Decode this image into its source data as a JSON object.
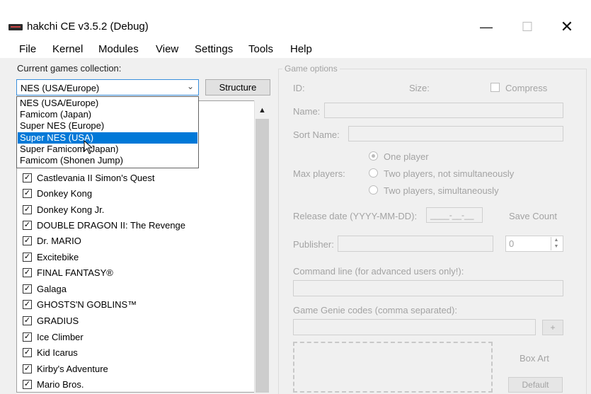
{
  "window": {
    "title": "hakchi CE v3.5.2 (Debug)",
    "minimize": "—",
    "maximize": "☐",
    "close": "✕"
  },
  "menu": [
    "File",
    "Kernel",
    "Modules",
    "View",
    "Settings",
    "Tools",
    "Help"
  ],
  "collection": {
    "label": "Current games collection:",
    "selected": "NES (USA/Europe)",
    "structure_button": "Structure",
    "options": [
      "NES (USA/Europe)",
      "Famicom (Japan)",
      "Super NES (Europe)",
      "Super NES (USA)",
      "Super Famicom (Japan)",
      "Famicom (Shonen Jump)"
    ],
    "highlighted_index": 3
  },
  "games": [
    "Castlevania II Simon's Quest",
    "Donkey Kong",
    "Donkey Kong Jr.",
    "DOUBLE DRAGON II: The Revenge",
    "Dr. MARIO",
    "Excitebike",
    "FINAL FANTASY®",
    "Galaga",
    "GHOSTS'N GOBLINS™",
    "GRADIUS",
    "Ice Climber",
    "Kid Icarus",
    "Kirby's Adventure",
    "Mario Bros."
  ],
  "options": {
    "legend": "Game options",
    "id_label": "ID:",
    "size_label": "Size:",
    "compress_label": "Compress",
    "name_label": "Name:",
    "sort_name_label": "Sort Name:",
    "max_players_label": "Max players:",
    "radio_one": "One player",
    "radio_two_not_sim": "Two players, not simultaneously",
    "radio_two_sim": "Two players, simultaneously",
    "release_label": "Release date (YYYY-MM-DD):",
    "release_value": "____-__-__",
    "save_count_label": "Save Count",
    "save_count_value": "0",
    "publisher_label": "Publisher:",
    "command_line_label": "Command line (for advanced users only!):",
    "game_genie_label": "Game Genie codes (comma separated):",
    "add_button": "+",
    "box_art_label": "Box Art",
    "default_button": "Default"
  }
}
